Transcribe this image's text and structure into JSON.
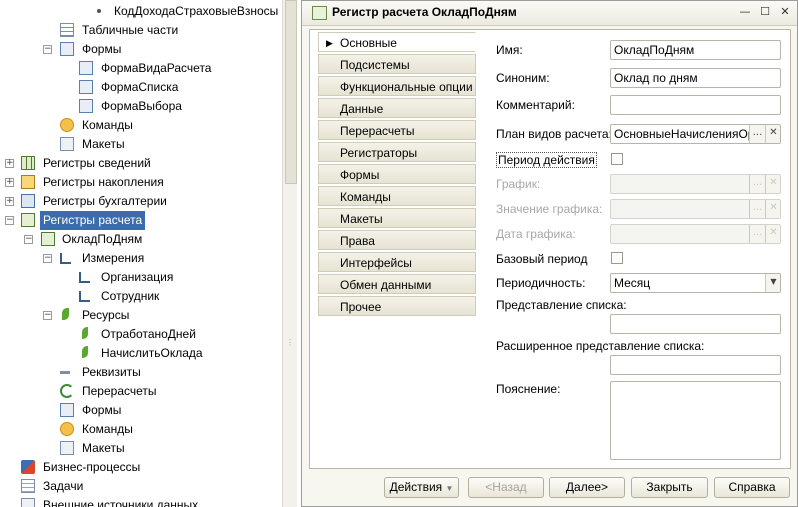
{
  "tree": {
    "items": [
      {
        "label": "КодДоходаСтраховыеВзносы",
        "icon": "attribute-icon"
      },
      {
        "label": "Табличные части",
        "icon": "tabular-sections-icon"
      },
      {
        "label": "Формы",
        "icon": "forms-icon"
      },
      {
        "label": "ФормаВидаРасчета",
        "icon": "form-icon"
      },
      {
        "label": "ФормаСписка",
        "icon": "form-icon"
      },
      {
        "label": "ФормаВыбора",
        "icon": "form-icon"
      },
      {
        "label": "Команды",
        "icon": "commands-icon"
      },
      {
        "label": "Макеты",
        "icon": "templates-icon"
      },
      {
        "label": "Регистры сведений",
        "icon": "information-registers-icon"
      },
      {
        "label": "Регистры накопления",
        "icon": "accumulation-registers-icon"
      },
      {
        "label": "Регистры бухгалтерии",
        "icon": "accounting-registers-icon"
      },
      {
        "label": "Регистры расчета",
        "icon": "calculation-registers-icon"
      },
      {
        "label": "ОкладПоДням",
        "icon": "calculation-register-icon"
      },
      {
        "label": "Измерения",
        "icon": "dimensions-icon"
      },
      {
        "label": "Организация",
        "icon": "dimension-icon"
      },
      {
        "label": "Сотрудник",
        "icon": "dimension-icon"
      },
      {
        "label": "Ресурсы",
        "icon": "resources-icon"
      },
      {
        "label": "ОтработаноДней",
        "icon": "resource-icon"
      },
      {
        "label": "НачислитьОклада",
        "icon": "resource-icon"
      },
      {
        "label": "Реквизиты",
        "icon": "attributes-icon"
      },
      {
        "label": "Перерасчеты",
        "icon": "recalculations-icon"
      },
      {
        "label": "Формы",
        "icon": "forms-icon"
      },
      {
        "label": "Команды",
        "icon": "commands-icon"
      },
      {
        "label": "Макеты",
        "icon": "templates-icon"
      },
      {
        "label": "Бизнес-процессы",
        "icon": "business-processes-icon"
      },
      {
        "label": "Задачи",
        "icon": "tasks-icon"
      },
      {
        "label": "Внешние источники данных",
        "icon": "external-sources-icon"
      }
    ]
  },
  "window": {
    "title": "Регистр расчета ОкладПоДням",
    "buttons": {
      "minimize": "—",
      "maximize": "☐",
      "close": "✕"
    }
  },
  "tabs": [
    "Основные",
    "Подсистемы",
    "Функциональные опции",
    "Данные",
    "Перерасчеты",
    "Регистраторы",
    "Формы",
    "Команды",
    "Макеты",
    "Права",
    "Интерфейсы",
    "Обмен данными",
    "Прочее"
  ],
  "form": {
    "name_label": "Имя:",
    "name_value": "ОкладПоДням",
    "synonym_label": "Синоним:",
    "synonym_value": "Оклад по дням",
    "comment_label": "Комментарий:",
    "comment_value": "",
    "plan_label": "План видов расчета:",
    "plan_value": "ОсновныеНачисленияОрганизаций",
    "period_label": "Период действия",
    "schedule_label": "График:",
    "schedule_value_label": "Значение графика:",
    "schedule_date_label": "Дата графика:",
    "base_period_label": "Базовый период",
    "periodicity_label": "Периодичность:",
    "periodicity_value": "Месяц",
    "list_repr_label": "Представление списка:",
    "ext_list_repr_label": "Расширенное представление списка:",
    "explanation_label": "Пояснение:",
    "select_glyph": "...",
    "clear_glyph": "✕",
    "dropdown_glyph": "▼"
  },
  "footer": {
    "actions": "Действия",
    "back": "<Назад",
    "next": "Далее>",
    "close": "Закрыть",
    "help": "Справка"
  }
}
